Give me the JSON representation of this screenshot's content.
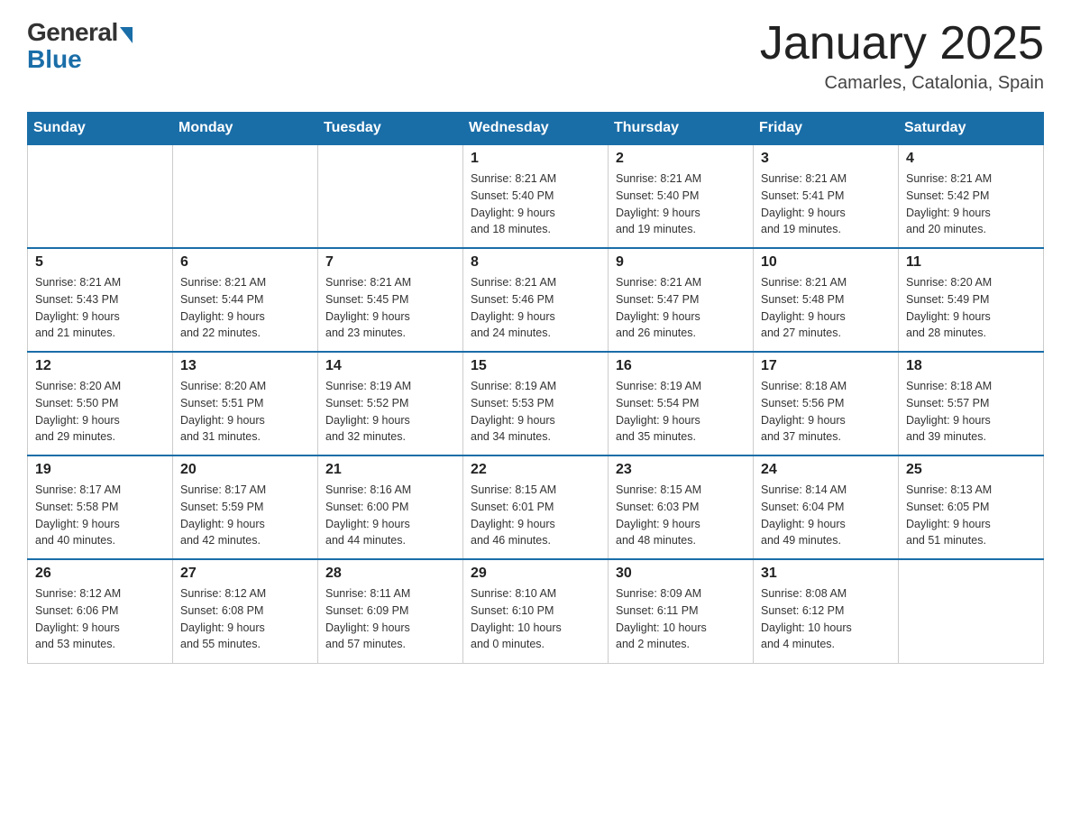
{
  "logo": {
    "general": "General",
    "blue": "Blue"
  },
  "header": {
    "month": "January 2025",
    "location": "Camarles, Catalonia, Spain"
  },
  "weekdays": [
    "Sunday",
    "Monday",
    "Tuesday",
    "Wednesday",
    "Thursday",
    "Friday",
    "Saturday"
  ],
  "weeks": [
    [
      {
        "day": "",
        "info": ""
      },
      {
        "day": "",
        "info": ""
      },
      {
        "day": "",
        "info": ""
      },
      {
        "day": "1",
        "info": "Sunrise: 8:21 AM\nSunset: 5:40 PM\nDaylight: 9 hours\nand 18 minutes."
      },
      {
        "day": "2",
        "info": "Sunrise: 8:21 AM\nSunset: 5:40 PM\nDaylight: 9 hours\nand 19 minutes."
      },
      {
        "day": "3",
        "info": "Sunrise: 8:21 AM\nSunset: 5:41 PM\nDaylight: 9 hours\nand 19 minutes."
      },
      {
        "day": "4",
        "info": "Sunrise: 8:21 AM\nSunset: 5:42 PM\nDaylight: 9 hours\nand 20 minutes."
      }
    ],
    [
      {
        "day": "5",
        "info": "Sunrise: 8:21 AM\nSunset: 5:43 PM\nDaylight: 9 hours\nand 21 minutes."
      },
      {
        "day": "6",
        "info": "Sunrise: 8:21 AM\nSunset: 5:44 PM\nDaylight: 9 hours\nand 22 minutes."
      },
      {
        "day": "7",
        "info": "Sunrise: 8:21 AM\nSunset: 5:45 PM\nDaylight: 9 hours\nand 23 minutes."
      },
      {
        "day": "8",
        "info": "Sunrise: 8:21 AM\nSunset: 5:46 PM\nDaylight: 9 hours\nand 24 minutes."
      },
      {
        "day": "9",
        "info": "Sunrise: 8:21 AM\nSunset: 5:47 PM\nDaylight: 9 hours\nand 26 minutes."
      },
      {
        "day": "10",
        "info": "Sunrise: 8:21 AM\nSunset: 5:48 PM\nDaylight: 9 hours\nand 27 minutes."
      },
      {
        "day": "11",
        "info": "Sunrise: 8:20 AM\nSunset: 5:49 PM\nDaylight: 9 hours\nand 28 minutes."
      }
    ],
    [
      {
        "day": "12",
        "info": "Sunrise: 8:20 AM\nSunset: 5:50 PM\nDaylight: 9 hours\nand 29 minutes."
      },
      {
        "day": "13",
        "info": "Sunrise: 8:20 AM\nSunset: 5:51 PM\nDaylight: 9 hours\nand 31 minutes."
      },
      {
        "day": "14",
        "info": "Sunrise: 8:19 AM\nSunset: 5:52 PM\nDaylight: 9 hours\nand 32 minutes."
      },
      {
        "day": "15",
        "info": "Sunrise: 8:19 AM\nSunset: 5:53 PM\nDaylight: 9 hours\nand 34 minutes."
      },
      {
        "day": "16",
        "info": "Sunrise: 8:19 AM\nSunset: 5:54 PM\nDaylight: 9 hours\nand 35 minutes."
      },
      {
        "day": "17",
        "info": "Sunrise: 8:18 AM\nSunset: 5:56 PM\nDaylight: 9 hours\nand 37 minutes."
      },
      {
        "day": "18",
        "info": "Sunrise: 8:18 AM\nSunset: 5:57 PM\nDaylight: 9 hours\nand 39 minutes."
      }
    ],
    [
      {
        "day": "19",
        "info": "Sunrise: 8:17 AM\nSunset: 5:58 PM\nDaylight: 9 hours\nand 40 minutes."
      },
      {
        "day": "20",
        "info": "Sunrise: 8:17 AM\nSunset: 5:59 PM\nDaylight: 9 hours\nand 42 minutes."
      },
      {
        "day": "21",
        "info": "Sunrise: 8:16 AM\nSunset: 6:00 PM\nDaylight: 9 hours\nand 44 minutes."
      },
      {
        "day": "22",
        "info": "Sunrise: 8:15 AM\nSunset: 6:01 PM\nDaylight: 9 hours\nand 46 minutes."
      },
      {
        "day": "23",
        "info": "Sunrise: 8:15 AM\nSunset: 6:03 PM\nDaylight: 9 hours\nand 48 minutes."
      },
      {
        "day": "24",
        "info": "Sunrise: 8:14 AM\nSunset: 6:04 PM\nDaylight: 9 hours\nand 49 minutes."
      },
      {
        "day": "25",
        "info": "Sunrise: 8:13 AM\nSunset: 6:05 PM\nDaylight: 9 hours\nand 51 minutes."
      }
    ],
    [
      {
        "day": "26",
        "info": "Sunrise: 8:12 AM\nSunset: 6:06 PM\nDaylight: 9 hours\nand 53 minutes."
      },
      {
        "day": "27",
        "info": "Sunrise: 8:12 AM\nSunset: 6:08 PM\nDaylight: 9 hours\nand 55 minutes."
      },
      {
        "day": "28",
        "info": "Sunrise: 8:11 AM\nSunset: 6:09 PM\nDaylight: 9 hours\nand 57 minutes."
      },
      {
        "day": "29",
        "info": "Sunrise: 8:10 AM\nSunset: 6:10 PM\nDaylight: 10 hours\nand 0 minutes."
      },
      {
        "day": "30",
        "info": "Sunrise: 8:09 AM\nSunset: 6:11 PM\nDaylight: 10 hours\nand 2 minutes."
      },
      {
        "day": "31",
        "info": "Sunrise: 8:08 AM\nSunset: 6:12 PM\nDaylight: 10 hours\nand 4 minutes."
      },
      {
        "day": "",
        "info": ""
      }
    ]
  ]
}
